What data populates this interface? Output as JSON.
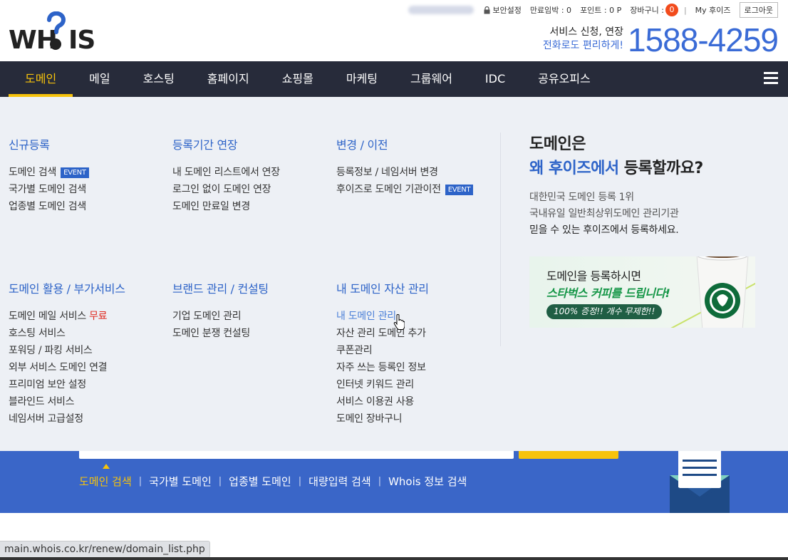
{
  "topbar": {
    "security": "보안설정",
    "expiry": "만료임박 : 0",
    "points": "포인트 : 0 P",
    "cart_label": "장바구니 :",
    "cart_count": "0",
    "separator": "|",
    "my_whois": "My 후이즈",
    "logout": "로그아웃"
  },
  "logo": {
    "text": "WHOIS"
  },
  "phone": {
    "line1": "서비스 신청, 연장",
    "line2": "전화로도 편리하게!",
    "number": "1588-4259"
  },
  "nav": {
    "items": [
      "도메인",
      "메일",
      "호스팅",
      "홈페이지",
      "쇼핑몰",
      "마케팅",
      "그룹웨어",
      "IDC",
      "공유오피스"
    ]
  },
  "menu": {
    "new_reg": {
      "title": "신규등록",
      "items": [
        "도메인 검색",
        "국가별 도메인 검색",
        "업종별 도메인 검색"
      ],
      "event_tag": "EVENT"
    },
    "extend": {
      "title": "등록기간 연장",
      "items": [
        "내 도메인 리스트에서 연장",
        "로그인 없이 도메인 연장",
        "도메인 만료일 변경"
      ]
    },
    "transfer": {
      "title": "변경 / 이전",
      "items": [
        "등록정보 / 네임서버 변경",
        "후이즈로 도메인 기관이전"
      ],
      "event_tag": "EVENT"
    },
    "addon": {
      "title": "도메인 활용 / 부가서비스",
      "item0_prefix": "도메인 메일 서비스 ",
      "item0_free": "무료",
      "items": [
        "호스팅 서비스",
        "포워딩 / 파킹 서비스",
        "외부 서비스 도메인 연결",
        "프리미엄 보안 설정",
        "블라인드 서비스",
        "네임서버 고급설정"
      ]
    },
    "brand": {
      "title": "브랜드 관리 / 컨설팅",
      "items": [
        "기업 도메인 관리",
        "도메인 분쟁 컨설팅"
      ]
    },
    "assets": {
      "title": "내 도메인 자산 관리",
      "items": [
        "내 도메인 관리",
        "자산 관리 도메인 추가",
        "쿠폰관리",
        "자주 쓰는 등록인 정보",
        "인터넷 키워드 관리",
        "서비스 이용권 사용",
        "도메인 장바구니"
      ]
    }
  },
  "promo": {
    "title_line1": "도메인은",
    "title_blue": "왜 후이즈에서",
    "title_rest": " 등록할까요?",
    "desc1": "대한민국 도메인 등록 1위",
    "desc2": "국내유일 일반최상위도메인 관리기관",
    "desc3": "믿을 수 있는 후이즈에서 등록하세요.",
    "banner_line1": "도메인을 등록하시면",
    "banner_line2": "스타벅스 커피를 드립니다!",
    "banner_pill": "100% 증정!!  개수 무제한!!"
  },
  "search_links": {
    "items": [
      "도메인 검색",
      "국가별 도메인",
      "업종별 도메인",
      "대량입력 검색",
      "Whois 정보 검색"
    ],
    "sep": "|"
  },
  "status_url": "main.whois.co.kr/renew/domain_list.php",
  "colors": {
    "nav_bg": "#272b3a",
    "accent_yellow": "#f7c30b",
    "brand_blue": "#2d63c8",
    "band_blue": "#3a66c8",
    "badge_orange": "#f24b1c"
  },
  "icons": [
    "lock-icon",
    "hamburger-icon",
    "coffee-cup-icon",
    "envelope-icon",
    "hand-cursor-icon"
  ]
}
